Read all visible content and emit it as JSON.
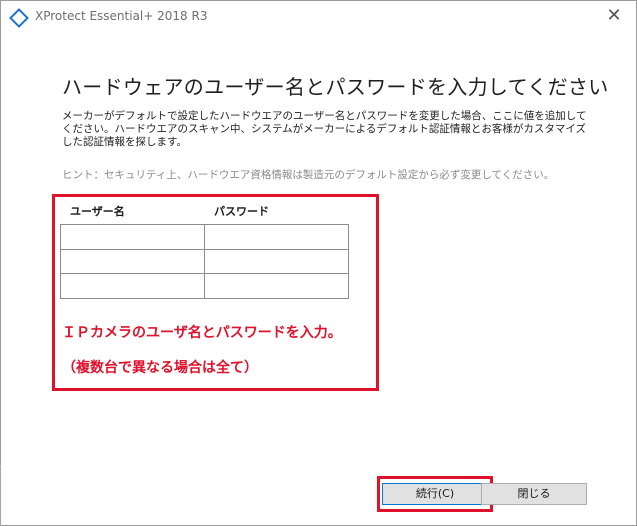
{
  "window": {
    "title": "XProtect Essential+ 2018 R3",
    "close_glyph": "✕"
  },
  "page": {
    "heading": "ハードウェアのユーザー名とパスワードを入力してください",
    "description": "メーカーがデフォルトで設定したハードウエアのユーザー名とパスワードを変更した場合、ここに値を追加してください。ハードウエアのスキャン中、システムがメーカーによるデフォルト認証情報とお客様がカスタマイズした認証情報を探します。",
    "hint": "ヒント：セキュリティ上、ハードウエア資格情報は製造元のデフォルト設定から必ず変更してください。"
  },
  "credentials_table": {
    "columns": [
      "ユーザー名",
      "パスワード"
    ],
    "rows": [
      {
        "username": "",
        "password": ""
      },
      {
        "username": "",
        "password": ""
      },
      {
        "username": "",
        "password": ""
      }
    ]
  },
  "annotation": {
    "line1": "ＩＰカメラのユーザ名とパスワードを入力。",
    "line2": "（複数台で異なる場合は全て）",
    "color": "#e0112b"
  },
  "buttons": {
    "continue_label": "続行(C)",
    "close_label": "閉じる"
  },
  "colors": {
    "accent": "#1a74c8",
    "highlight": "#e0112b"
  }
}
